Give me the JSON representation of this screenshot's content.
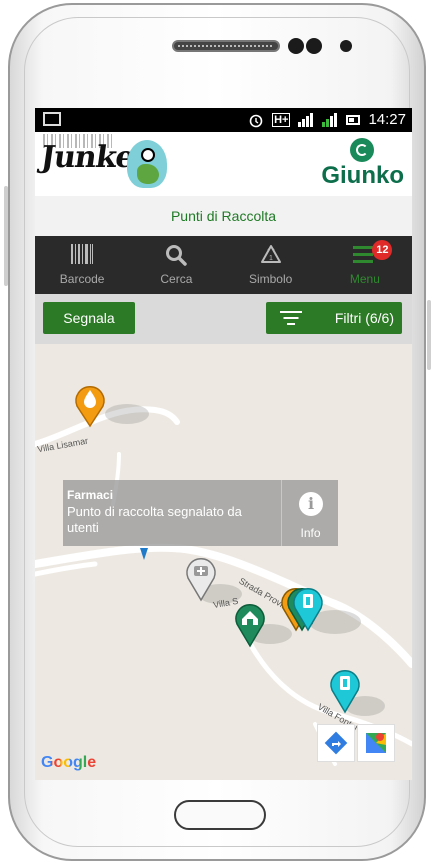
{
  "status_bar": {
    "time": "14:27",
    "network": "H+",
    "alarm_icon": "alarm-icon",
    "signal_icon": "signal-icon",
    "battery_icon": "battery-icon"
  },
  "header": {
    "left_logo": "Junker",
    "right_logo": "Giunko"
  },
  "title_bar": {
    "title": "Punti di Raccolta"
  },
  "nav": {
    "items": [
      {
        "label": "Barcode",
        "icon": "barcode-icon"
      },
      {
        "label": "Cerca",
        "icon": "search-icon"
      },
      {
        "label": "Simbolo",
        "icon": "recycle-icon"
      },
      {
        "label": "Menu",
        "icon": "menu-icon",
        "badge": "12"
      }
    ]
  },
  "toolbar": {
    "report_label": "Segnala",
    "filters_label": "Filtri (6/6)"
  },
  "map": {
    "popup": {
      "title": "Farmaci",
      "description": "Punto di raccolta segnalato da utenti",
      "info_label": "Info"
    },
    "road_labels": [
      "Villa Lisamar",
      "Strada Provinciale 18",
      "Villa S",
      "Villa Fontana"
    ],
    "attribution": "Google",
    "colors": {
      "brand_green": "#2c7a26",
      "pin_orange": "#f39c12",
      "pin_teal": "#1ec8d6",
      "pin_green": "#1f8a5b",
      "pin_gray": "#c9c9c9",
      "badge_red": "#e02a2a"
    }
  }
}
